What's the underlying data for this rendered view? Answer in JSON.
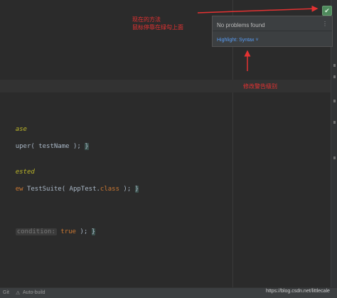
{
  "editor": {
    "code_lines": [
      {
        "annotation": "ase"
      },
      {
        "text": "uper( testName );",
        "close": "}"
      },
      {
        "annotation": "ested"
      },
      {
        "keyword": "ew",
        "text": " TestSuite( AppTest.",
        "keyword2": "class",
        "tail": " );",
        "close": "}"
      },
      {
        "hint": "condition:",
        "keyword": "true",
        "tail": " );",
        "close": "}"
      }
    ]
  },
  "inspection_popup": {
    "title": "No problems found",
    "more": "⋮",
    "highlight_link": "Highlight: Syntax ˅"
  },
  "annotations": {
    "note1_line1": "现在的方法",
    "note1_line2": "鼠标停靠在绿勾上面",
    "note2": "修改警告级别"
  },
  "status_bar": {
    "git": "Git",
    "warning_glyph": "⚠",
    "autobuild": "Auto-build",
    "watermark": "https://blog.csdn.net/littlecale"
  },
  "colors": {
    "background": "#2b2b2b",
    "annotation_red": "#e53232",
    "link_blue": "#589df6",
    "check_green": "#4e8a5c"
  }
}
